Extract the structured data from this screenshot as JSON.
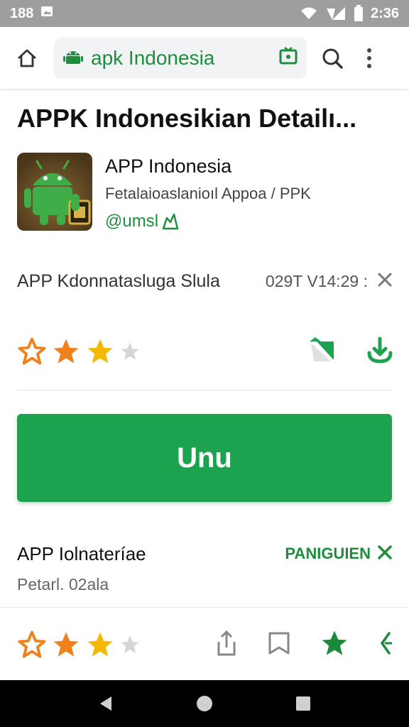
{
  "status_bar": {
    "time_left": "188",
    "time_right": "2:36"
  },
  "toolbar": {
    "url": "apk Indonesia"
  },
  "page": {
    "title": "APPK Indonesikian Detailı..."
  },
  "app": {
    "name": "APP Indonesia",
    "subtitle": "Fetalaioaslanioıl Appoa / PPK",
    "developer": "@umsl"
  },
  "meta": {
    "label": "APP Kdonnatasluga Slula",
    "value": "029T V14:29 :"
  },
  "rating": {
    "value": 3,
    "max": 4
  },
  "primary_button": {
    "label": "Unu"
  },
  "info": {
    "title": "APP Iolnateríae",
    "link": "PANIGUIEN",
    "subtitle": "Petarl. 02ala"
  },
  "bottom_rating": {
    "value": 3,
    "max": 4
  },
  "colors": {
    "accent": "#1da350",
    "star_orange": "#f0821e",
    "star_yellow": "#f5b800",
    "star_empty": "#d6d6d6"
  },
  "icons": [
    "home-icon",
    "android-icon",
    "tab-icon",
    "search-icon",
    "more-icon",
    "close-icon",
    "share-icon",
    "download-icon",
    "bookmark-icon",
    "star-icon",
    "back-icon"
  ]
}
